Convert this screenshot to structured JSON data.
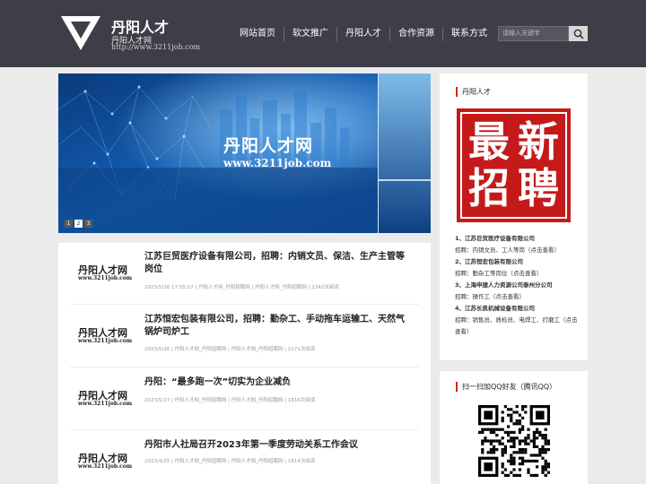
{
  "header": {
    "title": "丹阳人才",
    "subtitle": "丹阳人才网",
    "url": "http://www.3211job.com",
    "nav": [
      "网站首页",
      "软文推广",
      "丹阳人才",
      "合作资源",
      "联系方式"
    ],
    "search_placeholder": "请输入关键字"
  },
  "banner": {
    "title": "丹阳人才网",
    "url": "www.3211job.com",
    "dots": [
      "1",
      "2",
      "3"
    ]
  },
  "thumb": {
    "title": "丹阳人才网",
    "url": "www.3211job.com"
  },
  "articles": [
    {
      "title": "江苏巨贸医疗设备有限公司，招聘：内销文员、保洁、生产主管等岗位",
      "meta": "2023/5/26 17:55:17 | 丹阳人才网_丹阳招聘网 | 丹阳人才网_丹阳招聘网 | 2342次阅读"
    },
    {
      "title": "江苏恒宏包装有限公司，招聘：勤杂工、手动拖车运输工、天然气锅炉司炉工",
      "meta": "2023/5/26 | 丹阳人才网_丹阳招聘网 | 丹阳人才网_丹阳招聘网 | 2171次阅读"
    },
    {
      "title": "丹阳：“最多跑一次”切实为企业减负",
      "meta": "2023/5/17 | 丹阳人才网_丹阳招聘网 | 丹阳人才网_丹阳招聘网 | 1816次阅读"
    },
    {
      "title": "丹阳市人社局召开2023年第一季度劳动关系工作会议",
      "meta": "2023/4/25 | 丹阳人才网_丹阳招聘网 | 丹阳人才网_丹阳招聘网 | 1814次阅读"
    }
  ],
  "sidebar": {
    "title": "丹阳人才",
    "stamp": [
      "最",
      "新",
      "招",
      "聘"
    ],
    "jobs": [
      {
        "name": "1、江苏巨贸医疗设备有限公司",
        "desc": "招聘：内销文员、工人等岗（点击查看）"
      },
      {
        "name": "2、江苏恒宏包装有限公司",
        "desc": "招聘：勤杂工等岗位（点击查看）"
      },
      {
        "name": "3、上海申捷人力资源公司泰州分公司",
        "desc": "招聘：操作工（点击查看）"
      },
      {
        "name": "4、江苏长凯机械设备有限公司",
        "desc": "招聘：销售员、质检员、电焊工、打磨工（点击查看）"
      }
    ],
    "qr_title": "扫一扫加QQ好友（腾讯QQ）"
  },
  "colors": {
    "header_bg": "#3d3e48",
    "accent_red": "#c62828",
    "page_bg": "#ebebeb"
  }
}
